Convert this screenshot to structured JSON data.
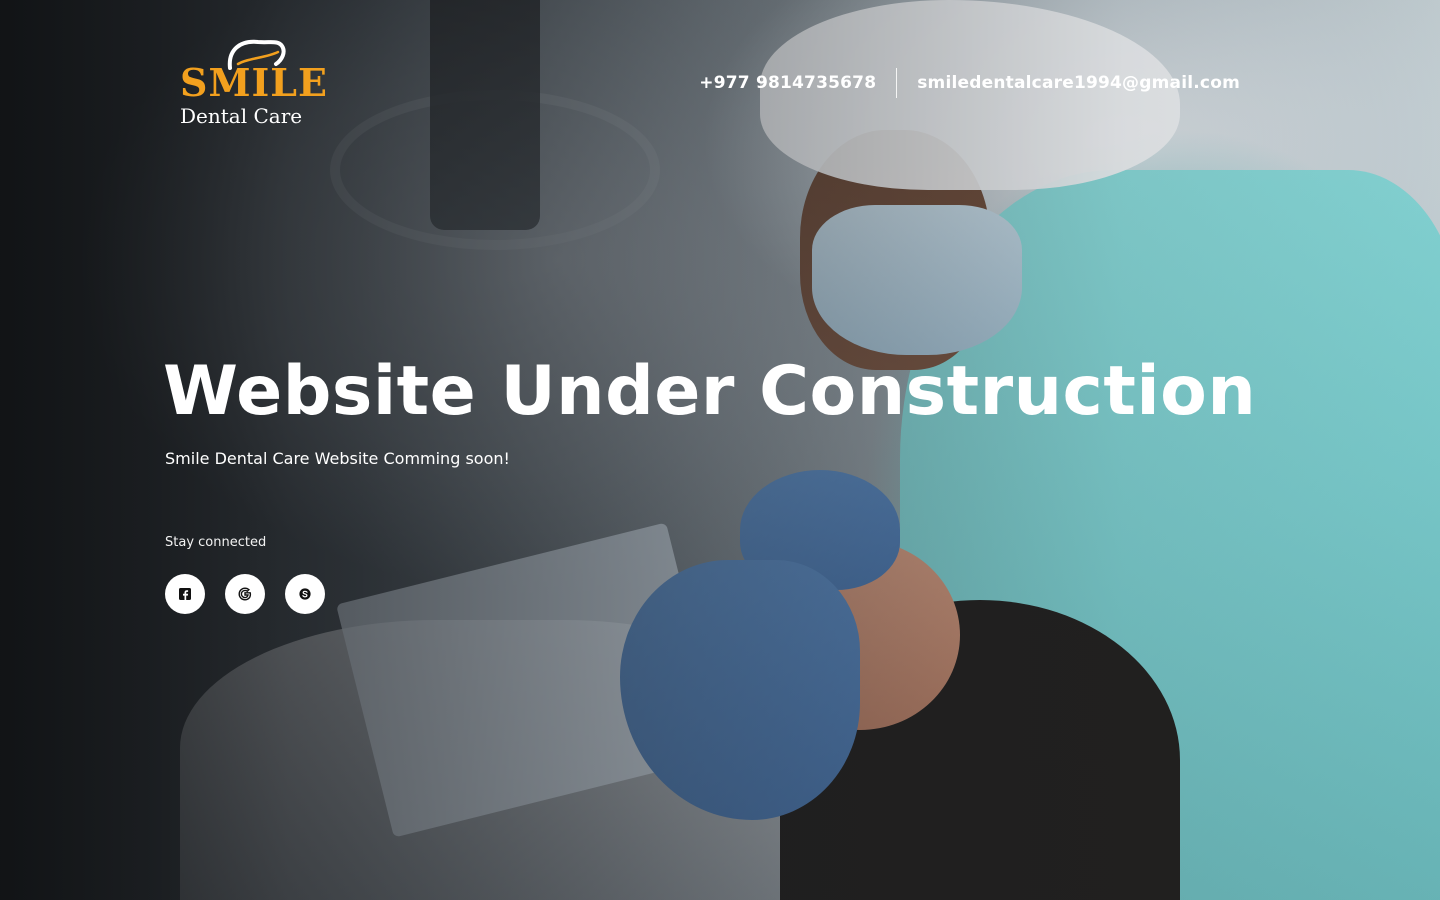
{
  "brand": {
    "logo_word": "SMILE",
    "logo_sub": "Dental Care",
    "accent_color": "#f2a01e"
  },
  "header": {
    "phone": "+977 9814735678",
    "email": "smiledentalcare1994@gmail.com"
  },
  "hero": {
    "title": "Website Under Construction",
    "subtitle": "Smile Dental Care Website Comming soon!",
    "background_photo": "dentist-treating-patient-photo"
  },
  "social": {
    "label": "Stay connected",
    "links": [
      {
        "icon": "facebook-icon"
      },
      {
        "icon": "google-icon"
      },
      {
        "icon": "skype-icon"
      }
    ]
  }
}
